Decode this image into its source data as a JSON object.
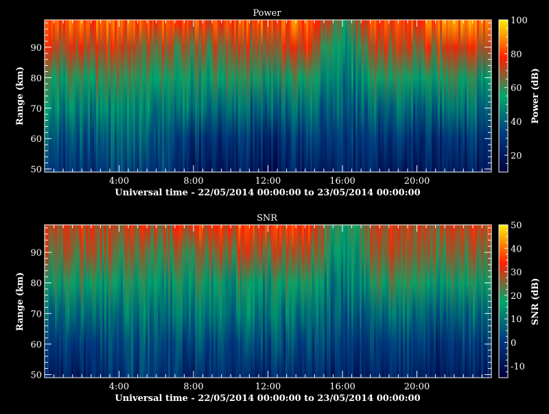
{
  "chart_data": [
    {
      "type": "heatmap",
      "title": "Power",
      "xlabel": "Universal time - 22/05/2014 00:00:00 to 23/05/2014 00:00:00",
      "ylabel": "Range (km)",
      "xlim": [
        0,
        24
      ],
      "ylim": [
        49,
        99
      ],
      "x_ticks": [
        "4:00",
        "8:00",
        "12:00",
        "16:00",
        "20:00"
      ],
      "x_tick_values": [
        4,
        8,
        12,
        16,
        20
      ],
      "y_ticks": [
        50,
        60,
        70,
        80,
        90
      ],
      "colorbar": {
        "label": "Power (dB)",
        "range": [
          10,
          100
        ],
        "ticks": [
          20,
          40,
          60,
          80,
          100
        ]
      },
      "profile": [
        {
          "t": 0.5,
          "p": [
            30,
            38,
            48,
            58,
            72,
            82
          ]
        },
        {
          "t": 2,
          "p": [
            28,
            36,
            46,
            58,
            72,
            83
          ]
        },
        {
          "t": 4,
          "p": [
            34,
            42,
            50,
            60,
            72,
            84
          ]
        },
        {
          "t": 6,
          "p": [
            34,
            40,
            48,
            58,
            68,
            82
          ]
        },
        {
          "t": 8,
          "p": [
            22,
            30,
            44,
            56,
            66,
            80
          ]
        },
        {
          "t": 10,
          "p": [
            20,
            28,
            42,
            55,
            66,
            80
          ]
        },
        {
          "t": 12,
          "p": [
            20,
            28,
            42,
            56,
            70,
            82
          ]
        },
        {
          "t": 14,
          "p": [
            22,
            30,
            44,
            58,
            74,
            84
          ]
        },
        {
          "t": 16,
          "p": [
            24,
            30,
            38,
            44,
            50,
            58
          ]
        },
        {
          "t": 18,
          "p": [
            22,
            30,
            42,
            56,
            70,
            80
          ]
        },
        {
          "t": 20,
          "p": [
            22,
            30,
            42,
            56,
            70,
            80
          ]
        },
        {
          "t": 22,
          "p": [
            20,
            28,
            42,
            56,
            72,
            88
          ]
        },
        {
          "t": 23.5,
          "p": [
            24,
            32,
            44,
            56,
            74,
            88
          ]
        }
      ],
      "colors": [
        "#00003c",
        "#003a80",
        "#00a86a",
        "#ff1f00",
        "#ffef00"
      ]
    },
    {
      "type": "heatmap",
      "title": "SNR",
      "xlabel": "Universal time - 22/05/2014 00:00:00 to 23/05/2014 00:00:00",
      "ylabel": "Range (km)",
      "xlim": [
        0,
        24
      ],
      "ylim": [
        49,
        99
      ],
      "x_ticks": [
        "4:00",
        "8:00",
        "12:00",
        "16:00",
        "20:00"
      ],
      "x_tick_values": [
        4,
        8,
        12,
        16,
        20
      ],
      "y_ticks": [
        50,
        60,
        70,
        80,
        90
      ],
      "colorbar": {
        "label": "SNR (dB)",
        "range": [
          -15,
          50
        ],
        "ticks": [
          -10,
          0,
          10,
          20,
          30,
          40,
          50
        ]
      },
      "profile": [
        {
          "t": 0.5,
          "p": [
            -6,
            0,
            8,
            18,
            26,
            30
          ]
        },
        {
          "t": 2,
          "p": [
            -6,
            0,
            8,
            18,
            26,
            30
          ]
        },
        {
          "t": 4,
          "p": [
            0,
            4,
            10,
            18,
            26,
            30
          ]
        },
        {
          "t": 6,
          "p": [
            0,
            4,
            10,
            16,
            24,
            28
          ]
        },
        {
          "t": 8,
          "p": [
            -4,
            2,
            10,
            16,
            24,
            32
          ]
        },
        {
          "t": 10,
          "p": [
            -4,
            2,
            10,
            16,
            26,
            32
          ]
        },
        {
          "t": 12,
          "p": [
            -4,
            2,
            10,
            16,
            26,
            34
          ]
        },
        {
          "t": 14,
          "p": [
            -4,
            2,
            10,
            18,
            28,
            34
          ]
        },
        {
          "t": 16,
          "p": [
            -6,
            0,
            4,
            8,
            12,
            16
          ]
        },
        {
          "t": 18,
          "p": [
            -6,
            0,
            8,
            18,
            26,
            30
          ]
        },
        {
          "t": 20,
          "p": [
            -6,
            0,
            8,
            18,
            24,
            28
          ]
        },
        {
          "t": 22,
          "p": [
            -8,
            -2,
            6,
            16,
            24,
            28
          ]
        },
        {
          "t": 23.5,
          "p": [
            -6,
            0,
            8,
            18,
            26,
            32
          ]
        }
      ],
      "colors": [
        "#00003c",
        "#003a80",
        "#00a86a",
        "#ff1f00",
        "#ffef00"
      ]
    }
  ]
}
